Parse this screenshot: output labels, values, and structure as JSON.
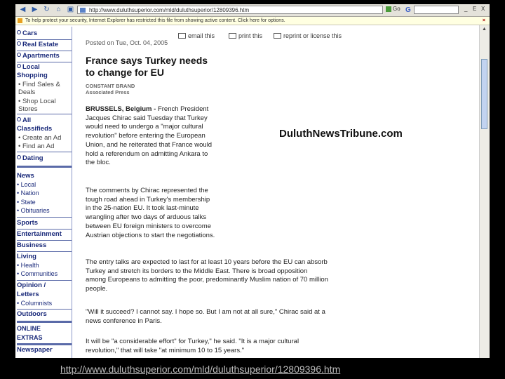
{
  "browser": {
    "address": "http://www.duluthsuperior.com/mld/duluthsuperior/12809396.htm",
    "go_label": "Go",
    "google_label": "G",
    "min_label": "_",
    "max_label": "E",
    "close_label": "X"
  },
  "infobar": {
    "text": "To help protect your security, Internet Explorer has restricted this file from showing active content. Click here for options."
  },
  "sidebar": {
    "classifieds_top": [
      {
        "label": "Cars"
      },
      {
        "label": "Real Estate"
      },
      {
        "label": "Apartments"
      },
      {
        "label": "Local Shopping",
        "label1": "Local",
        "label2": "Shopping"
      }
    ],
    "shopping_subs": [
      "Find Sales &",
      "Deals",
      "Shop Local",
      "Stores"
    ],
    "all_classifieds": {
      "label1": "All",
      "label2": "Classifieds"
    },
    "classified_subs": [
      "Create an Ad",
      "Find an Ad"
    ],
    "dating": "Dating",
    "news": "News",
    "news_subs": [
      "Local",
      "Nation",
      "State",
      "Obituaries"
    ],
    "sports": "Sports",
    "entertainment": "Entertainment",
    "business": "Business",
    "living": "Living",
    "living_subs": [
      "Health",
      "Communities"
    ],
    "opinion1": "Opinion /",
    "opinion2": "Letters",
    "opinion_subs": [
      "Columnists"
    ],
    "outdoors": "Outdoors",
    "online1": "ONLINE",
    "online2": "EXTRAS",
    "newspaper": "Newspaper"
  },
  "actions": {
    "email": "email this",
    "print": "print this",
    "license": "reprint or license this"
  },
  "article": {
    "posted": "Posted on Tue, Oct. 04, 2005",
    "headline1": "France says Turkey needs",
    "headline2": "to change for EU",
    "author": "CONSTANT BRAND",
    "agency": "Associated Press",
    "p1_dateline": "BRUSSELS, Belgium - ",
    "p1_lines": [
      "French President",
      "Jacques Chirac said Tuesday that Turkey",
      "would need to undergo a \"major cultural",
      "revolution\" before entering the European",
      "Union, and he reiterated that France would",
      "hold a referendum on admitting Ankara to",
      "the bloc."
    ],
    "p2_lines": [
      "The comments by Chirac represented the",
      "tough road ahead in Turkey's membership",
      "in the 25-nation EU. It took last-minute",
      "wrangling after two days of arduous talks",
      "between EU foreign ministers to overcome",
      "Austrian objections to start the negotiations."
    ],
    "p3_lines": [
      "The entry talks are expected to last for at least 10 years before the EU can absorb",
      "Turkey and stretch its borders to the Middle East. There is broad opposition",
      "among Europeans to admitting the poor, predominantly Muslim nation of 70 million",
      "people."
    ],
    "p4_lines": [
      "\"Will it succeed? I cannot say. I hope so. But I am not at all sure,\" Chirac said at a",
      "news conference in Paris."
    ],
    "p5_lines": [
      "It will be \"a considerable effort\" for Turkey,\" he said. \"It is a major cultural",
      "revolution,\" that will take \"at minimum 10 to 15 years.\""
    ]
  },
  "brand": "DuluthNewsTribune.com",
  "footer_url": "http://www.duluthsuperior.com/mld/duluthsuperior/12809396.htm"
}
